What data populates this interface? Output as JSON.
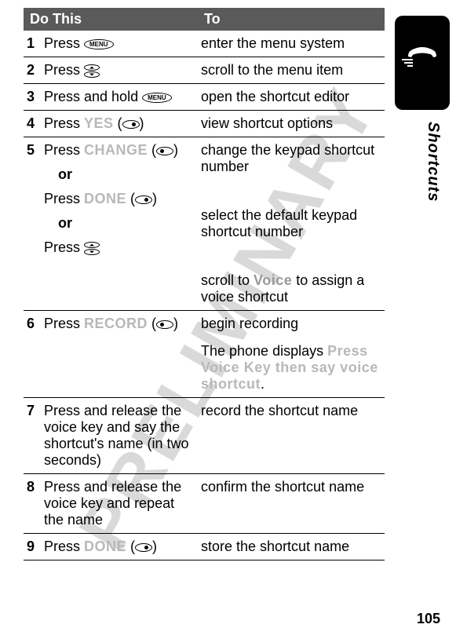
{
  "watermark": "PRELIMINARY",
  "section_label": "Shortcuts",
  "page_number": "105",
  "table": {
    "headers": {
      "do": "Do This",
      "to": "To"
    },
    "rows": {
      "r1": {
        "num": "1",
        "do_prefix": "Press ",
        "to": "enter the menu system"
      },
      "r2": {
        "num": "2",
        "do_prefix": "Press ",
        "to": "scroll to the menu item"
      },
      "r3": {
        "num": "3",
        "do_prefix": "Press and hold ",
        "to": "open the shortcut editor"
      },
      "r4": {
        "num": "4",
        "do_prefix": "Press ",
        "do_label": "YES",
        "do_suffix_open": " (",
        "do_suffix_close": ")",
        "to": "view shortcut options"
      },
      "r5": {
        "num": "5",
        "a": {
          "do_prefix": "Press ",
          "do_label": "CHANGE",
          "do_suffix_open": " (",
          "do_suffix_close": ")",
          "to": "change the keypad shortcut number"
        },
        "or1": "or",
        "b": {
          "do_prefix": "Press ",
          "do_label": "DONE",
          "do_suffix_open": " (",
          "do_suffix_close": ")",
          "to": "select the default keypad shortcut number"
        },
        "or2": "or",
        "c": {
          "do_prefix": "Press ",
          "to_prefix": "scroll to ",
          "to_label": "Voice",
          "to_suffix": " to assign a voice shortcut"
        }
      },
      "r6": {
        "num": "6",
        "do_prefix": "Press ",
        "do_label": "RECORD",
        "do_suffix_open": " (",
        "do_suffix_close": ")",
        "to1": "begin recording",
        "to2_prefix": "The phone displays ",
        "to2_label": "Press Voice Key then say voice shortcut",
        "to2_suffix": "."
      },
      "r7": {
        "num": "7",
        "do": "Press and release the voice key and say the shortcut's name (in two seconds)",
        "to": "record the shortcut name"
      },
      "r8": {
        "num": "8",
        "do": "Press and release the voice key and repeat the name",
        "to": "confirm the shortcut name"
      },
      "r9": {
        "num": "9",
        "do_prefix": "Press ",
        "do_label": "DONE",
        "do_suffix_open": " (",
        "do_suffix_close": ")",
        "to": "store the shortcut name"
      }
    }
  },
  "icons": {
    "menu": "MENU"
  }
}
